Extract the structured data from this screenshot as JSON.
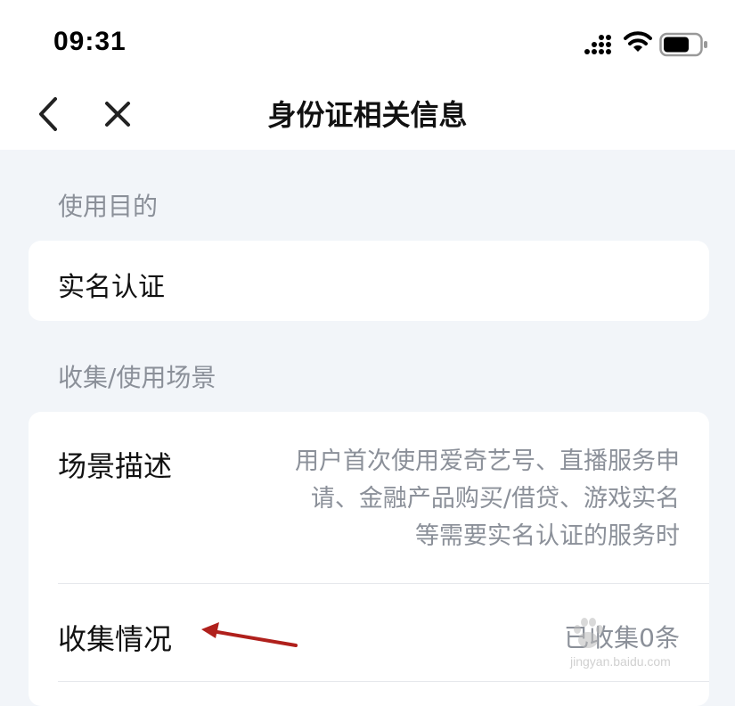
{
  "status_bar": {
    "time": "09:31"
  },
  "nav": {
    "title": "身份证相关信息"
  },
  "purpose": {
    "label": "使用目的",
    "value": "实名认证"
  },
  "scene": {
    "label": "收集/使用场景",
    "description_label": "场景描述",
    "description_lines": [
      "用户首次使用爱奇艺号、直播服务申",
      "请、金融产品购买/借贷、游戏实名",
      "等需要实名认证的服务时"
    ],
    "collection_label": "收集情况",
    "collection_value": "已收集0条"
  },
  "watermark": {
    "text": "jingyan.baidu.com",
    "logo": "Bai度经验"
  },
  "colors": {
    "background": "#f2f5f9",
    "card": "#ffffff",
    "arrow": "#b0201c"
  }
}
